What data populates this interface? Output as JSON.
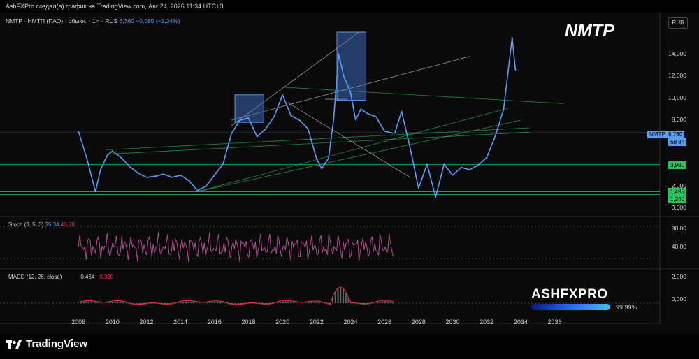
{
  "header": {
    "text": "AshFXPro создал(а) график на TradingView.com, Авг 24, 2026 11:34 UTC+3"
  },
  "symbol": {
    "desc": "NMTP · НМТП (ПАО) · обыкн. · 1H · RUS",
    "value": "6,760",
    "change": "−0,085 (−1,24%)"
  },
  "title": "NMTP",
  "currency": "RUB",
  "price_tags": [
    {
      "label": "NMTP",
      "value": "6,760",
      "sub": "6d 8h",
      "color": "#5b9cf6"
    },
    {
      "label": "",
      "value": "3,960",
      "sub": "",
      "color": "#22c55e"
    },
    {
      "label": "",
      "value": "1,495",
      "sub": "",
      "color": "#22c55e"
    },
    {
      "label": "",
      "value": "1,240",
      "sub": "",
      "color": "#22c55e"
    }
  ],
  "stoch": {
    "label": "Stoch (3, 5, 3)",
    "k": "35,34",
    "d": "40,38",
    "ticks": [
      "80,00",
      "40,00"
    ]
  },
  "macd": {
    "label": "MACD (12, 26, close)",
    "macd": "−0,464",
    "signal": "−0,330",
    "ticks": [
      "2,000",
      "0,000"
    ]
  },
  "branding": {
    "tv": "TradingView",
    "logo": "ASHFXPRO",
    "percent": "99.99%"
  },
  "colors": {
    "price": "#5b9cf6",
    "support": "#22c55e",
    "trend": "#d1d4dc",
    "stoch": "#b04d8d",
    "macd": "#f23645"
  },
  "chart_data": {
    "type": "line",
    "x_ticks": [
      "2008",
      "2010",
      "2012",
      "2014",
      "2016",
      "2018",
      "2020",
      "2022",
      "2024",
      "2026",
      "2028",
      "2030",
      "2032",
      "2034",
      "2036"
    ],
    "y_ticks": [
      "14,000",
      "12,000",
      "10,000",
      "8,000",
      "6,000",
      "4,000",
      "2,000",
      "0,000"
    ],
    "ylim": [
      0,
      16
    ],
    "xlim": [
      2007.5,
      2037.5
    ],
    "series": [
      {
        "x": [
          2008,
          2008.5,
          2009,
          2009.3,
          2009.7,
          2010,
          2010.5,
          2011,
          2011.5,
          2012,
          2012.5,
          2013,
          2013.5,
          2014,
          2014.5,
          2015,
          2015.5,
          2016,
          2016.5,
          2017,
          2017.5,
          2018,
          2018.5,
          2019,
          2019.5,
          2020,
          2020.5,
          2021,
          2021.5,
          2022,
          2022.3,
          2022.7,
          2023,
          2023.3,
          2023.6,
          2024,
          2024.3,
          2024.6,
          2025,
          2025.5,
          2026,
          2026.5
        ],
        "y": [
          7.0,
          4.5,
          1.5,
          3.5,
          4.8,
          5.2,
          4.6,
          3.8,
          3.2,
          2.8,
          2.9,
          3.1,
          2.8,
          3.0,
          2.5,
          1.6,
          2.0,
          3.0,
          4.0,
          6.8,
          8.0,
          8.2,
          6.5,
          7.2,
          8.3,
          10.3,
          8.4,
          8.0,
          7.2,
          4.5,
          3.6,
          4.5,
          8.0,
          14.0,
          12.0,
          10.5,
          8.0,
          9.0,
          8.6,
          8.3,
          7.0,
          6.8
        ]
      },
      {
        "name": "",
        "x": [
          2026.6,
          2027,
          2027.5,
          2028,
          2028.5,
          2029,
          2029.5,
          2030,
          2030.5,
          2031,
          2031.5,
          2032,
          2032.5,
          2033,
          2033.5,
          2033.7
        ],
        "y": [
          6.8,
          8.8,
          5.5,
          1.8,
          4.0,
          1.0,
          4.0,
          3.0,
          3.7,
          3.5,
          3.9,
          4.6,
          6.5,
          9.0,
          15.5,
          12.5
        ]
      }
    ]
  }
}
